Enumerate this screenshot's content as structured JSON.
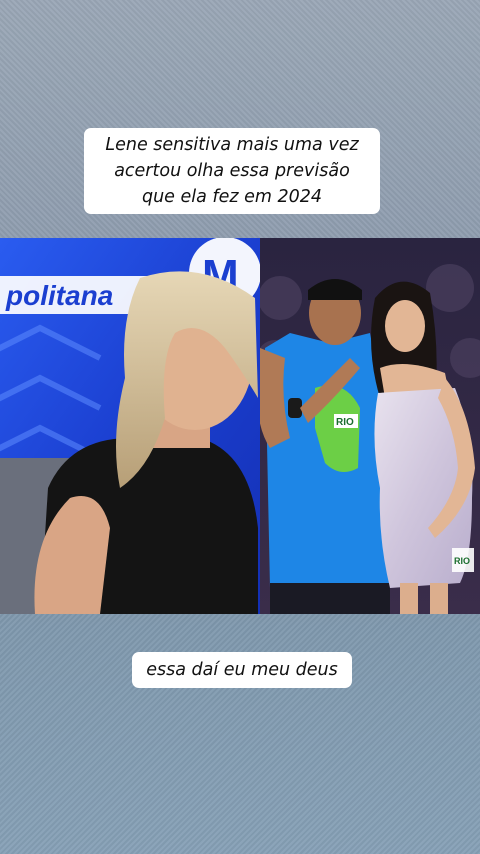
{
  "caption_top": {
    "lines": [
      "Lene sensitiva mais uma vez",
      "acertou olha essa previsão",
      "que ela fez em 2024"
    ]
  },
  "caption_bottom": {
    "text": "essa daí eu meu deus"
  },
  "left_video": {
    "studio_logo_text": "politana",
    "studio_logo_letter": "M"
  },
  "right_photo": {
    "shirt_badge_text": "RIO",
    "dress_badge_text": "RIO"
  }
}
